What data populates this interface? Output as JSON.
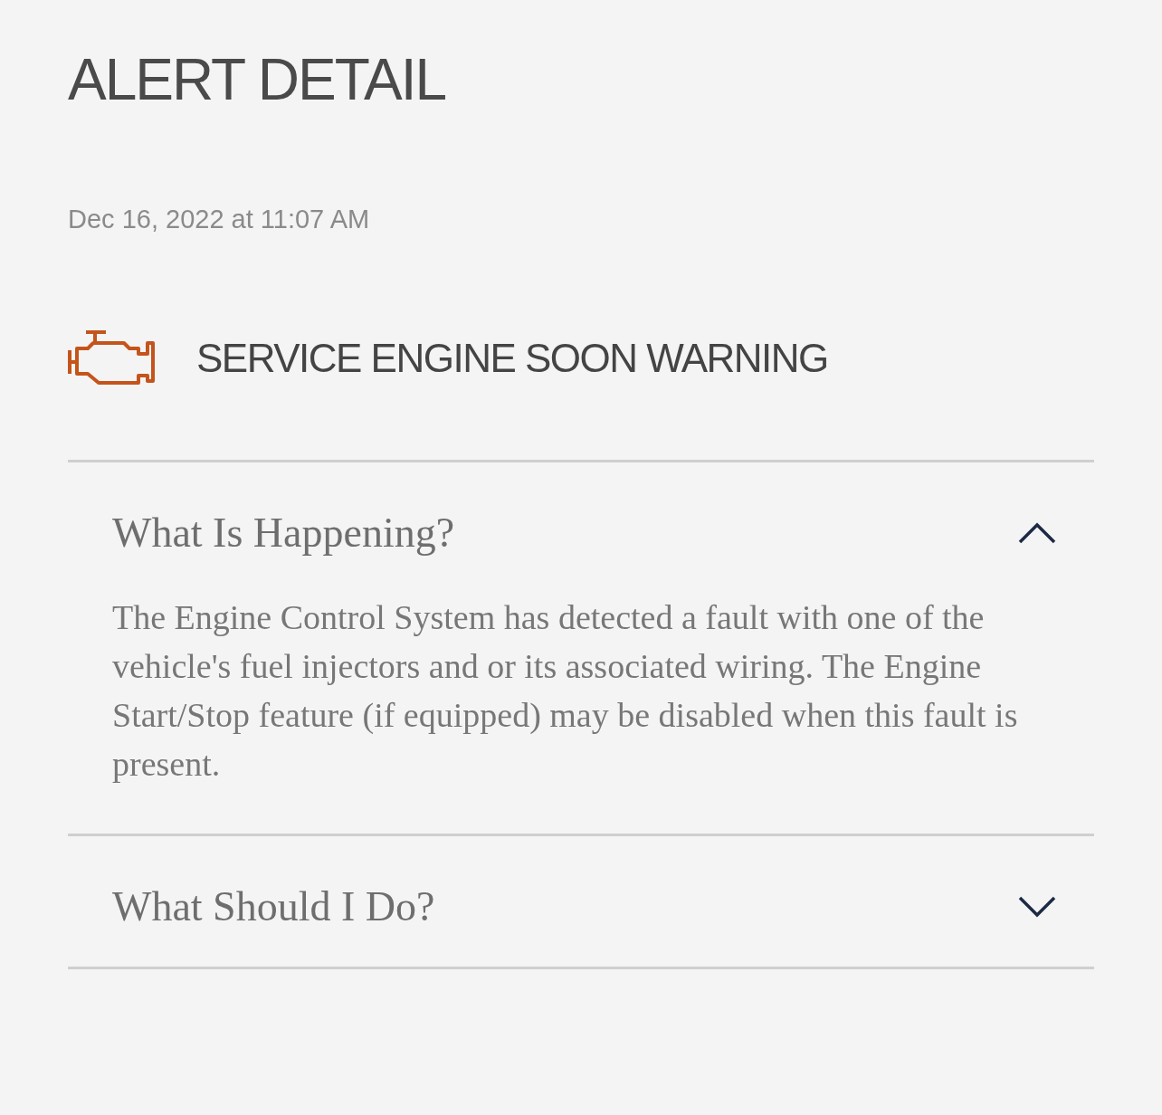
{
  "page_title": "ALERT DETAIL",
  "timestamp": "Dec 16, 2022 at 11:07 AM",
  "alert": {
    "title": "SERVICE ENGINE SOON WARNING"
  },
  "sections": [
    {
      "title": "What Is Happening?",
      "expanded": true,
      "body": "The Engine Control System has detected a fault with one of the vehicle's fuel injectors and or its associated wiring. The Engine Start/Stop feature (if equipped) may be disabled when this fault is present."
    },
    {
      "title": "What Should I Do?",
      "expanded": false
    }
  ]
}
